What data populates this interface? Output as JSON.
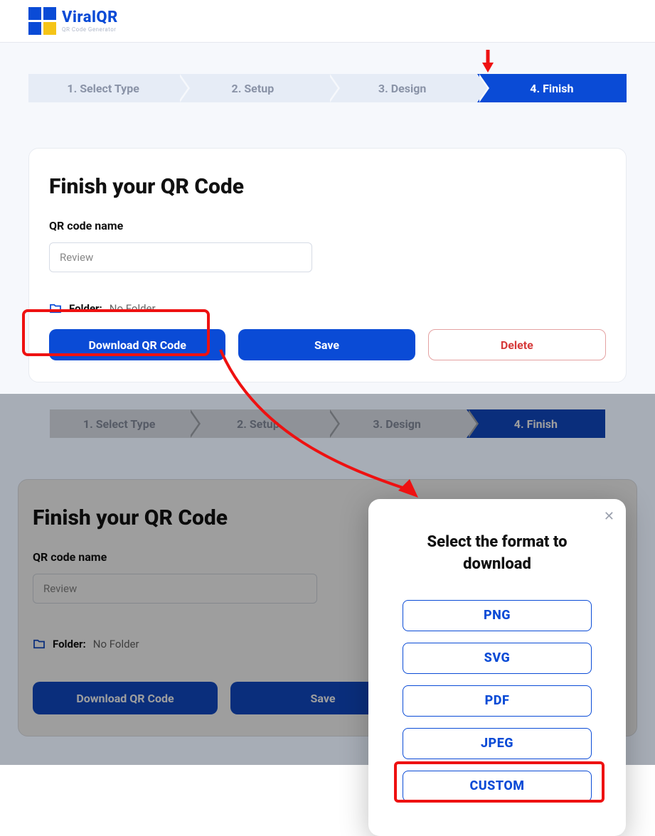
{
  "brand": {
    "name": "ViralQR",
    "tagline": "QR Code Generator"
  },
  "steps": [
    {
      "label": "1. Select Type"
    },
    {
      "label": "2. Setup"
    },
    {
      "label": "3. Design"
    },
    {
      "label": "4. Finish"
    }
  ],
  "finish": {
    "heading": "Finish your QR Code",
    "name_label": "QR code name",
    "name_value": "Review",
    "folder_label": "Folder:",
    "folder_value": "No Folder",
    "download_label": "Download QR Code",
    "save_label": "Save",
    "delete_label": "Delete"
  },
  "modal": {
    "title": "Select the format to download",
    "formats": [
      "PNG",
      "SVG",
      "PDF",
      "JPEG",
      "CUSTOM"
    ]
  }
}
